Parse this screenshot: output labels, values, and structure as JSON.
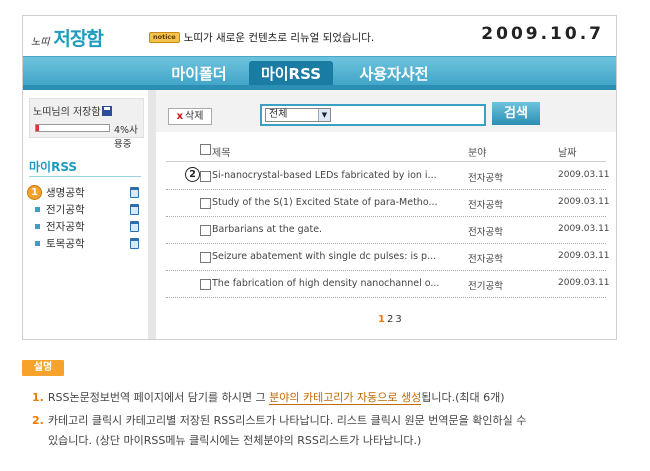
{
  "header": {
    "logo_small": "노띠",
    "logo_big": "저장함",
    "notice_badge": "notice",
    "notice_text": "노띠가 새로운 컨텐츠로 리뉴얼 되었습니다.",
    "date": "2009.10.7"
  },
  "nav": {
    "tabs": [
      {
        "label": "마이폴더"
      },
      {
        "label": "마이RSS"
      },
      {
        "label": "사용자사전"
      }
    ],
    "active": "마이RSS"
  },
  "sidebar": {
    "storage_title": "노띠님의 저장함",
    "storage_usage_percent": 4,
    "storage_usage_text": "4%사용중",
    "rss_heading": "마이RSS",
    "categories": [
      {
        "label": "생명공학"
      },
      {
        "label": "전기공학"
      },
      {
        "label": "전자공학"
      },
      {
        "label": "토목공학"
      }
    ]
  },
  "toolbar": {
    "delete_label": "삭제",
    "delete_x": "x",
    "select_value": "전체",
    "search_placeholder": "",
    "search_label": "검색"
  },
  "list": {
    "headers": {
      "title": "제목",
      "field": "분야",
      "date": "날짜"
    },
    "rows": [
      {
        "title": "Si-nanocrystal-based LEDs fabricated by ion i...",
        "field": "전자공학",
        "date": "2009.03.11"
      },
      {
        "title": "Study of the S(1) Excited State of para-Metho...",
        "field": "전자공학",
        "date": "2009.03.11"
      },
      {
        "title": "Barbarians at the gate.",
        "field": "전자공학",
        "date": "2009.03.11"
      },
      {
        "title": "Seizure abatement with single dc pulses: is p...",
        "field": "전자공학",
        "date": "2009.03.11"
      },
      {
        "title": "The fabrication of high density nanochannel o...",
        "field": "전기공학",
        "date": "2009.03.11"
      }
    ],
    "pages": [
      "1",
      "2",
      "3"
    ],
    "current_page": "1"
  },
  "markers": {
    "one": "1",
    "two": "2"
  },
  "explanation": {
    "badge": "설명",
    "items": [
      {
        "num": "1.",
        "before": "RSS논문정보번역 페이지에서 담기를 하시면 그 ",
        "highlight": "분야의 카테고리가 자동으로 생성",
        "after": "됩니다.(최대 6개)"
      },
      {
        "num": "2.",
        "line1": "카테고리 클릭시 카테고리별 저장된 RSS리스트가 나타납니다. 리스트 클릭시 원문 번역문을 확인하실 수",
        "line2": "있습니다. (상단 마이RSS메뉴 클릭시에는 전체분야의 RSS리스트가 나타납니다.)"
      }
    ]
  },
  "colors": {
    "accent": "#3aa0c4",
    "brand_text": "#1f9bc0",
    "orange": "#f5a32a",
    "storage_fill": "#d33"
  }
}
